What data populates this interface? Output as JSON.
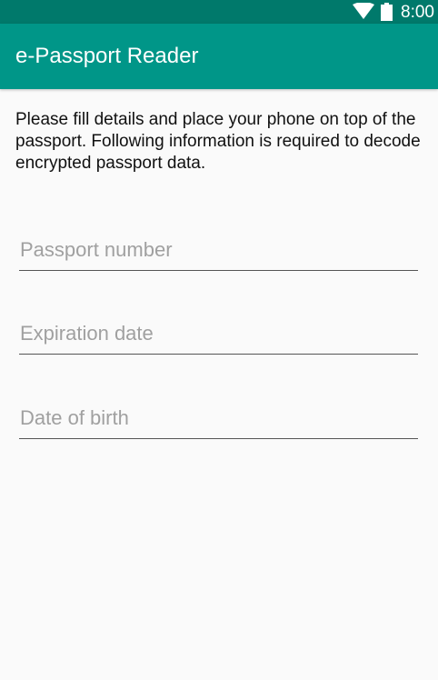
{
  "status_bar": {
    "time": "8:00",
    "icons": [
      "wifi-icon",
      "battery-icon"
    ]
  },
  "app_bar": {
    "title": "e-Passport Reader",
    "color": "#009688",
    "status_color": "#00796b"
  },
  "instructions": "Please fill details and place your phone on top of the passport. Following information is required to decode encrypted passport data.",
  "form": {
    "passport_number": {
      "placeholder": "Passport number",
      "value": ""
    },
    "expiration_date": {
      "placeholder": "Expiration date",
      "value": ""
    },
    "date_of_birth": {
      "placeholder": "Date of birth",
      "value": ""
    }
  }
}
